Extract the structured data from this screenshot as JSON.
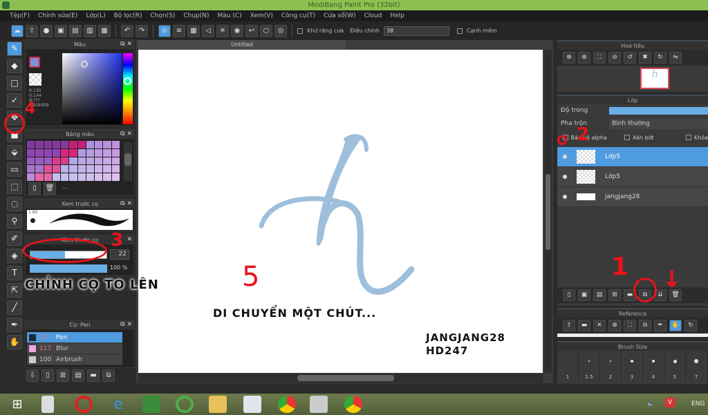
{
  "window": {
    "title": "MediBang Paint Pro (32bit)"
  },
  "menu": [
    "Tệp(F)",
    "Chỉnh sửa(E)",
    "Lớp(L)",
    "Bộ lọc(R)",
    "Chọn(S)",
    "Chụp(N)",
    "Màu (C)",
    "Xem(V)",
    "Công cụ(T)",
    "Cửa sổ(W)",
    "Cloud",
    "Help"
  ],
  "toolbar": {
    "antialias_label": "Khử răng cưa",
    "correction_label": "Điều chỉnh",
    "correction_value": "38",
    "edge_label": "Cạnh mềm"
  },
  "color_panel": {
    "title": "Màu",
    "r": "R:130",
    "g": "G:144",
    "b": "B:???",
    "hex": "#8290D9"
  },
  "palette_panel": {
    "title": "Bảng màu",
    "dash": "---"
  },
  "brush_preview": {
    "title": "Xem trước cọ",
    "size": "1.60"
  },
  "brush_size_panel": {
    "title": "Kích thước cọ",
    "size_value": "22",
    "size_fraction": 0.45,
    "opacity_value": "100 %"
  },
  "brush_list": {
    "title": "Cọ: Pen",
    "items": [
      {
        "size": "22",
        "name": "Pen",
        "color": "#1b2a3a"
      },
      {
        "size": "117",
        "name": "Blur",
        "color": "#f3a6e6"
      },
      {
        "size": "100",
        "name": "Airbrush",
        "color": "#cccccc"
      }
    ]
  },
  "canvas": {
    "tab": "Untitled"
  },
  "navigator": {
    "title": "Hoa tiêu"
  },
  "layers": {
    "title": "Lớp",
    "opacity_label": "Độ trong",
    "blend_label": "Pha trộn",
    "blend_value": "Bình thường",
    "protect_alpha": "Bảo vệ alpha",
    "clip": "Xén bớt",
    "lock": "Khóa",
    "items": [
      "Lớp5",
      "Lớp5",
      "jangjang28"
    ]
  },
  "reference": {
    "title": "Reference"
  },
  "brush_sizes": {
    "title": "Brush Size",
    "values": [
      "1",
      "1.5",
      "2",
      "3",
      "4",
      "5",
      "7"
    ]
  },
  "annotations": {
    "n1": "1",
    "n2": "2",
    "n3": "3",
    "n4": "4",
    "n5": "5",
    "adjust_text": "CHỈNH CỌ TO LÊN",
    "move_text": "DI CHUYỂN MỘT CHÚT...",
    "credit1": "JANGJANG28",
    "credit2": "HD247"
  },
  "taskbar": {
    "lang": "ENG"
  },
  "colors": {
    "accent": "#4f9be0",
    "titlebar": "#8cc152",
    "annotation": "#e8141b",
    "stroke": "#9dbfdb"
  }
}
